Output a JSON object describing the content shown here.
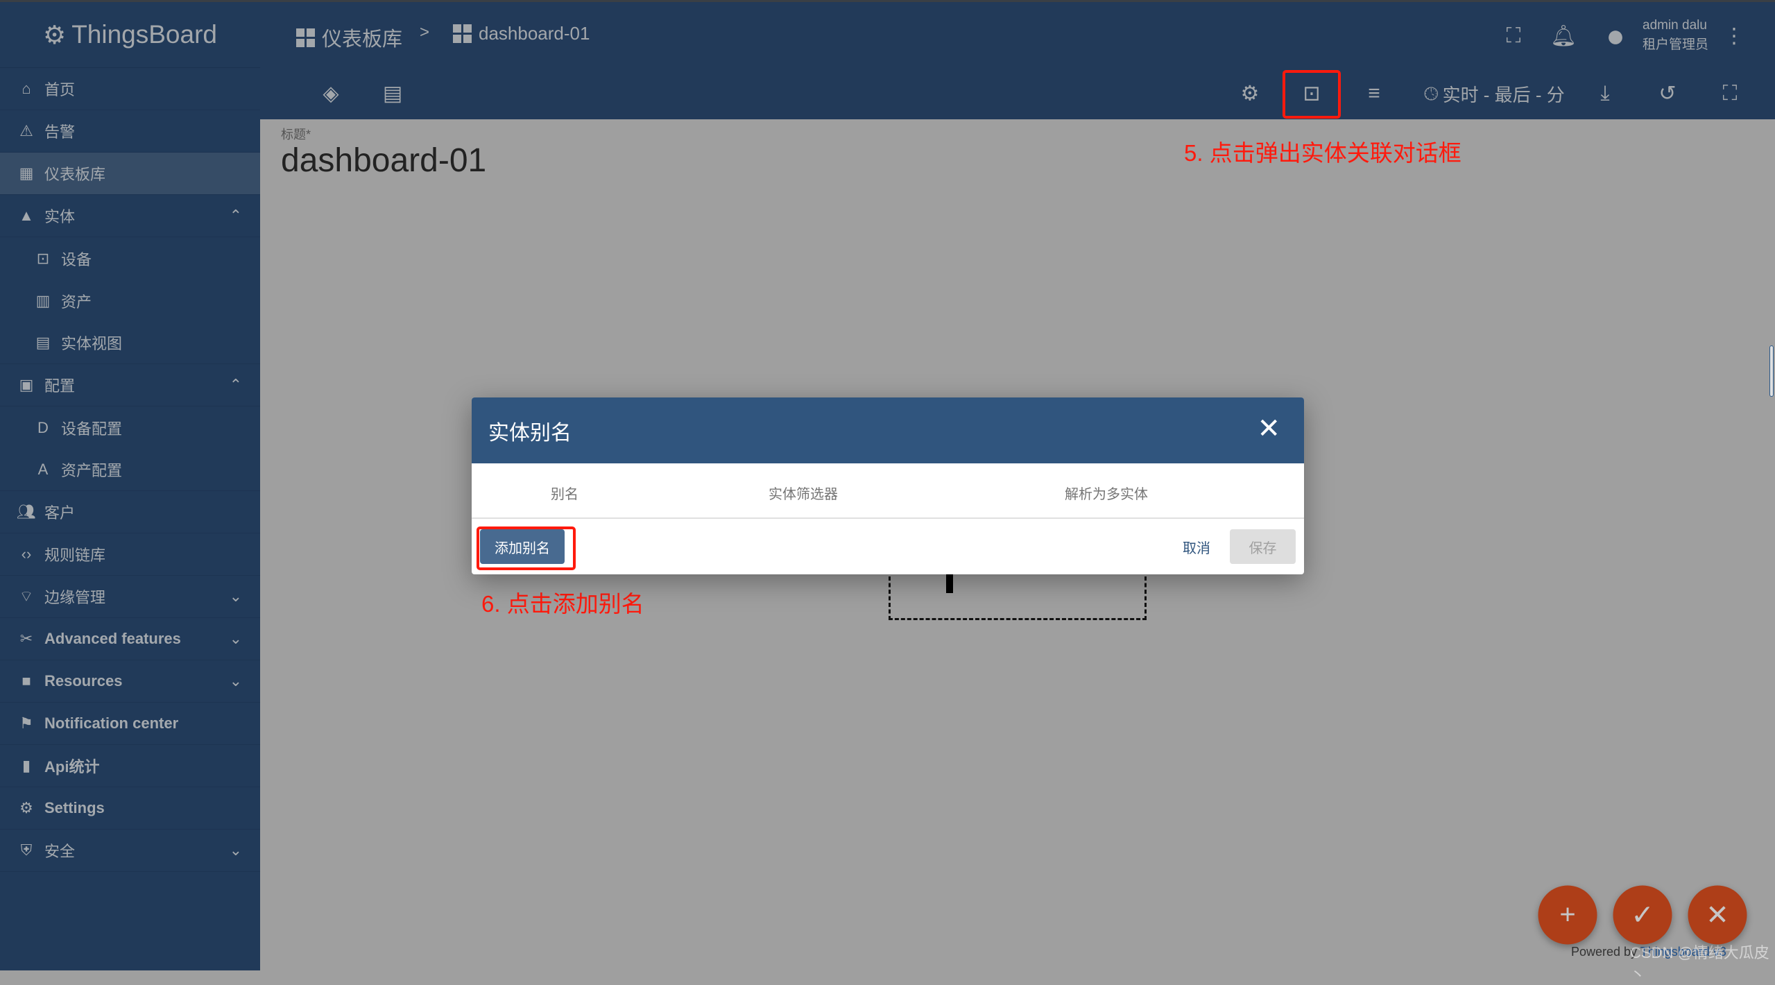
{
  "app": {
    "name": "ThingsBoard"
  },
  "sidebar": {
    "items": [
      {
        "label": "首页",
        "icon": "home-icon"
      },
      {
        "label": "告警",
        "icon": "warning-icon"
      },
      {
        "label": "仪表板库",
        "icon": "dashboard-icon",
        "active": true
      },
      {
        "label": "实体",
        "icon": "category-icon",
        "expanded": true
      },
      {
        "label": "设备",
        "icon": "devices-icon",
        "sub": true
      },
      {
        "label": "资产",
        "icon": "domain-icon",
        "sub": true
      },
      {
        "label": "实体视图",
        "icon": "view-quilt-icon",
        "sub": true
      },
      {
        "label": "配置",
        "icon": "badge-icon",
        "expanded": true
      },
      {
        "label": "设备配置",
        "icon": "device-profile-icon",
        "sub": true
      },
      {
        "label": "资产配置",
        "icon": "asset-profile-icon",
        "sub": true
      },
      {
        "label": "客户",
        "icon": "people-icon"
      },
      {
        "label": "规则链库",
        "icon": "settings-ethernet-icon"
      },
      {
        "label": "边缘管理",
        "icon": "router-icon",
        "collapsed": true
      },
      {
        "label": "Advanced features",
        "icon": "build-icon",
        "collapsed": true
      },
      {
        "label": "Resources",
        "icon": "folder-icon",
        "collapsed": true
      },
      {
        "label": "Notification center",
        "icon": "notification-icon"
      },
      {
        "label": "Api统计",
        "icon": "insert-chart-icon"
      },
      {
        "label": "Settings",
        "icon": "gear-icon"
      },
      {
        "label": "安全",
        "icon": "security-icon",
        "collapsed": true
      }
    ]
  },
  "header": {
    "breadcrumb": [
      "仪表板库",
      "dashboard-01"
    ],
    "separator": ">",
    "user_name": "admin dalu",
    "user_role": "租户管理员",
    "timewindow": "实时 - 最后 - 分"
  },
  "main": {
    "title_label": "标题*",
    "title": "dashboard-01"
  },
  "annotations": {
    "step5": "5. 点击弹出实体关联对话框",
    "step6": "6. 点击添加别名"
  },
  "dialog": {
    "title": "实体别名",
    "columns": [
      "别名",
      "实体筛选器",
      "解析为多实体"
    ],
    "add_button": "添加别名",
    "cancel_button": "取消",
    "save_button": "保存"
  },
  "footer": {
    "powered_by": "Powered by",
    "brand_link": "Thingsboard v3",
    "watermark": "CSDN @情绪大瓜皮丶"
  },
  "colors": {
    "sidebar": "#213a59",
    "dialog_header": "#30557e",
    "fab": "#ae3e18",
    "annotation": "#ff1a0d"
  }
}
